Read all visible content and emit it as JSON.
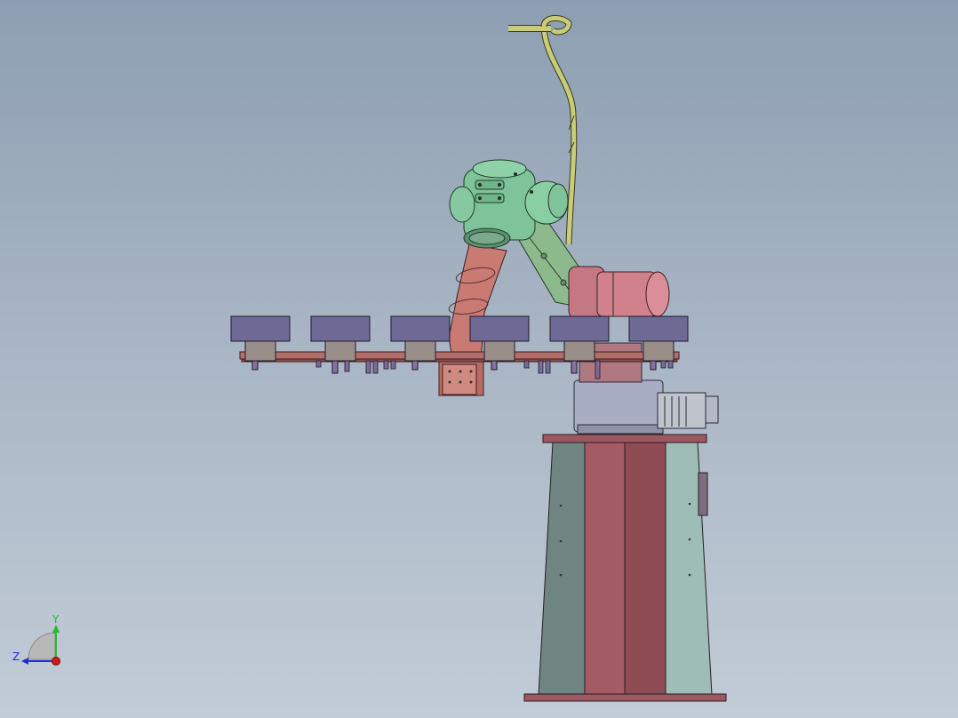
{
  "triad": {
    "y_label": "Y",
    "z_label": "Z",
    "y_color": "#1fbf2a",
    "z_color": "#1f2fd0",
    "x_color": "#d01818"
  },
  "colors": {
    "background_top": "#8d9fb3",
    "background_bottom": "#c2ccd7",
    "pedestal_gray": "#6f8582",
    "pedestal_red": "#a45c64",
    "pedestal_teal": "#9fbdb7",
    "base_drum": "#a9adc4",
    "motor_pink": "#d1818c",
    "arm_pink": "#c97a72",
    "head_green": "#7fc39a",
    "cable_yellow": "#c9cc78",
    "gripper_purple": "#6e6a95",
    "gripper_body": "#9a8f88",
    "rail": "#b36d6a"
  }
}
